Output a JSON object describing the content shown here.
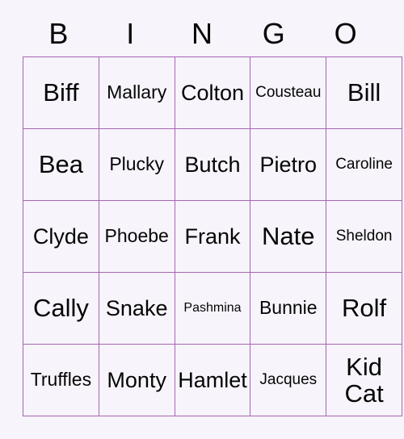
{
  "card": {
    "title": "BINGO",
    "background_color": "#f7f4fb",
    "border_color": "#a566b0",
    "text_color": "#050505",
    "header": [
      {
        "label": "B"
      },
      {
        "label": "I"
      },
      {
        "label": "N"
      },
      {
        "label": "G"
      },
      {
        "label": "O"
      }
    ],
    "columns": 5,
    "rows": 5,
    "cells": [
      [
        {
          "text": "Biff",
          "size": "xl"
        },
        {
          "text": "Mallary",
          "size": "md"
        },
        {
          "text": "Colton",
          "size": "lg"
        },
        {
          "text": "Cousteau",
          "size": "sm"
        },
        {
          "text": "Bill",
          "size": "xl"
        }
      ],
      [
        {
          "text": "Bea",
          "size": "xl"
        },
        {
          "text": "Plucky",
          "size": "md"
        },
        {
          "text": "Butch",
          "size": "lg"
        },
        {
          "text": "Pietro",
          "size": "lg"
        },
        {
          "text": "Caroline",
          "size": "sm"
        }
      ],
      [
        {
          "text": "Clyde",
          "size": "lg"
        },
        {
          "text": "Phoebe",
          "size": "md"
        },
        {
          "text": "Frank",
          "size": "lg"
        },
        {
          "text": "Nate",
          "size": "xl"
        },
        {
          "text": "Sheldon",
          "size": "sm"
        }
      ],
      [
        {
          "text": "Cally",
          "size": "xl"
        },
        {
          "text": "Snake",
          "size": "lg"
        },
        {
          "text": "Pashmina",
          "size": "xs"
        },
        {
          "text": "Bunnie",
          "size": "md"
        },
        {
          "text": "Rolf",
          "size": "xl"
        }
      ],
      [
        {
          "text": "Truffles",
          "size": "md"
        },
        {
          "text": "Monty",
          "size": "lg"
        },
        {
          "text": "Hamlet",
          "size": "lg"
        },
        {
          "text": "Jacques",
          "size": "sm"
        },
        {
          "text": "Kid Cat",
          "size": "xl",
          "wrap": true
        }
      ]
    ]
  }
}
